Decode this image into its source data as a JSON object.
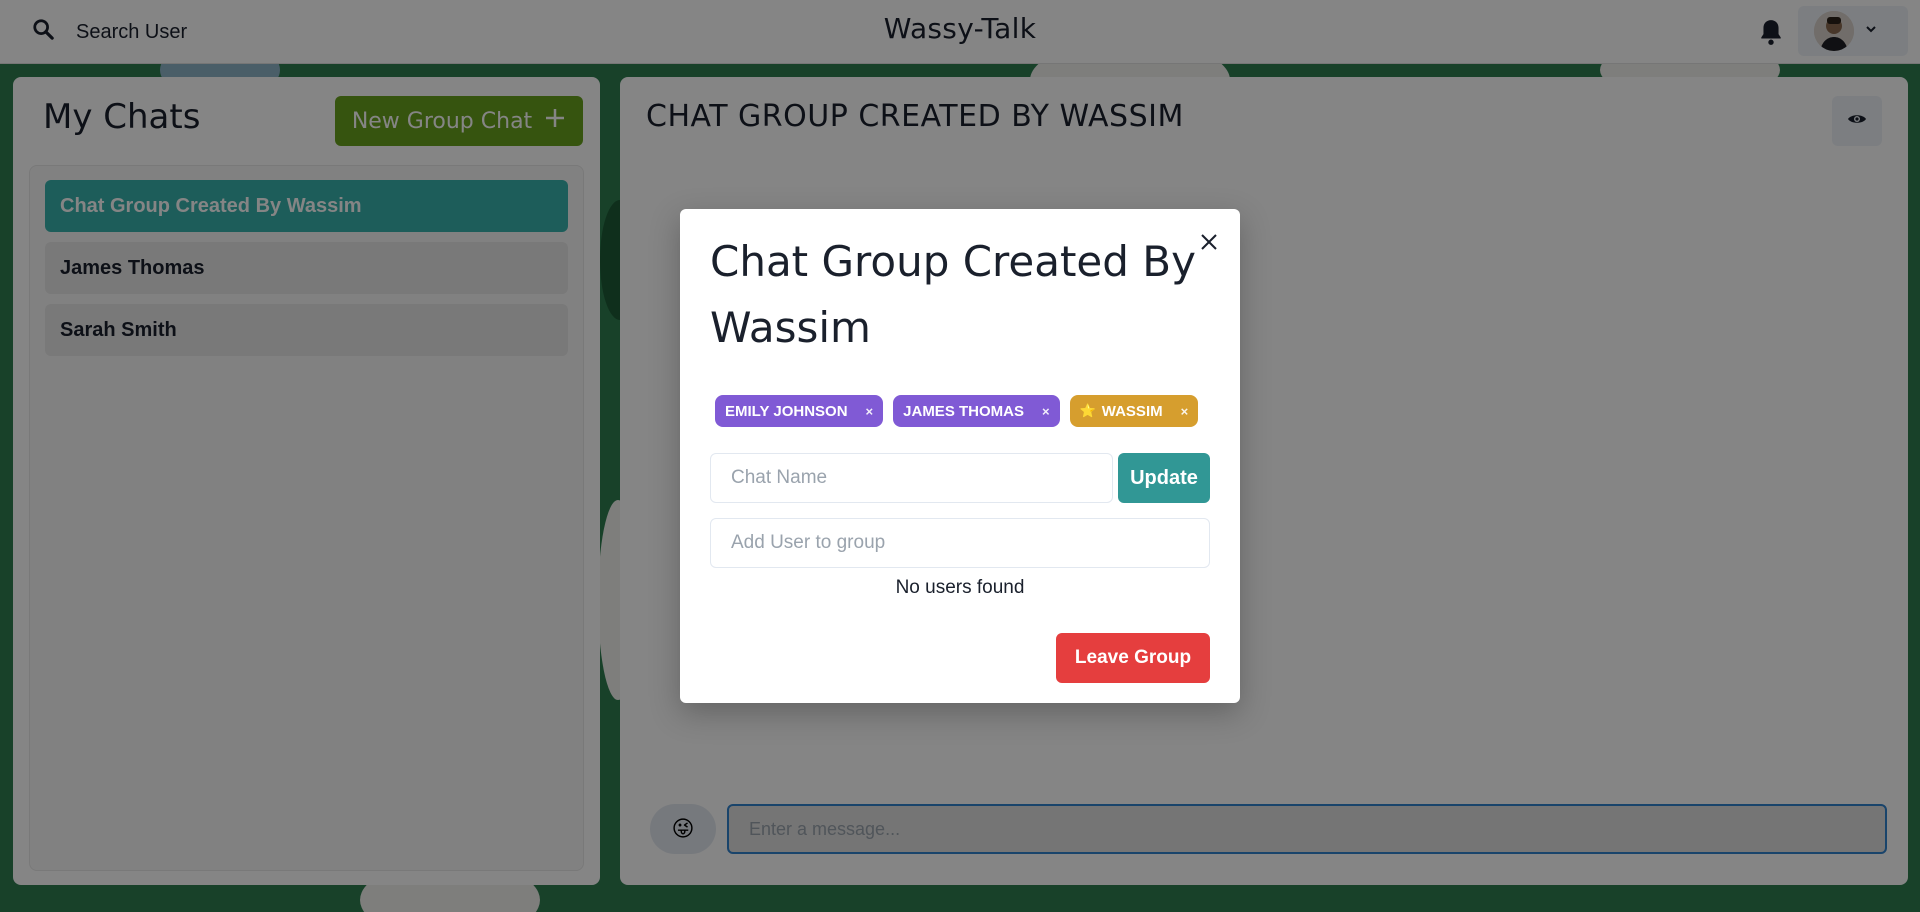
{
  "header": {
    "search_label": "Search User",
    "app_title": "Wassy-Talk"
  },
  "my_chats": {
    "title": "My Chats",
    "new_group_label": "New Group Chat",
    "items": [
      {
        "label": "Chat Group Created By Wassim",
        "active": true
      },
      {
        "label": "James Thomas",
        "active": false
      },
      {
        "label": "Sarah Smith",
        "active": false
      }
    ]
  },
  "chat_box": {
    "title": "CHAT GROUP CREATED BY WASSIM",
    "message_placeholder": "Enter a message...",
    "emoji": "😜"
  },
  "modal": {
    "title": "Chat Group Created By Wassim",
    "members": [
      {
        "name": "EMILY JOHNSON",
        "color": "#805ad5",
        "admin": false
      },
      {
        "name": "JAMES THOMAS",
        "color": "#805ad5",
        "admin": false
      },
      {
        "name": "WASSIM",
        "color": "#d69e2e",
        "admin": true
      }
    ],
    "remove_glyph": "×",
    "admin_glyph": "⭐",
    "chat_name_placeholder": "Chat Name",
    "update_label": "Update",
    "add_user_placeholder": "Add User to group",
    "no_users_text": "No users found",
    "leave_label": "Leave Group"
  },
  "colors": {
    "accent_teal": "#38b2ac",
    "update_teal": "#319795",
    "new_group_green": "#68a21e",
    "leave_red": "#e53e3e",
    "member_purple": "#805ad5",
    "admin_orange": "#d69e2e"
  }
}
